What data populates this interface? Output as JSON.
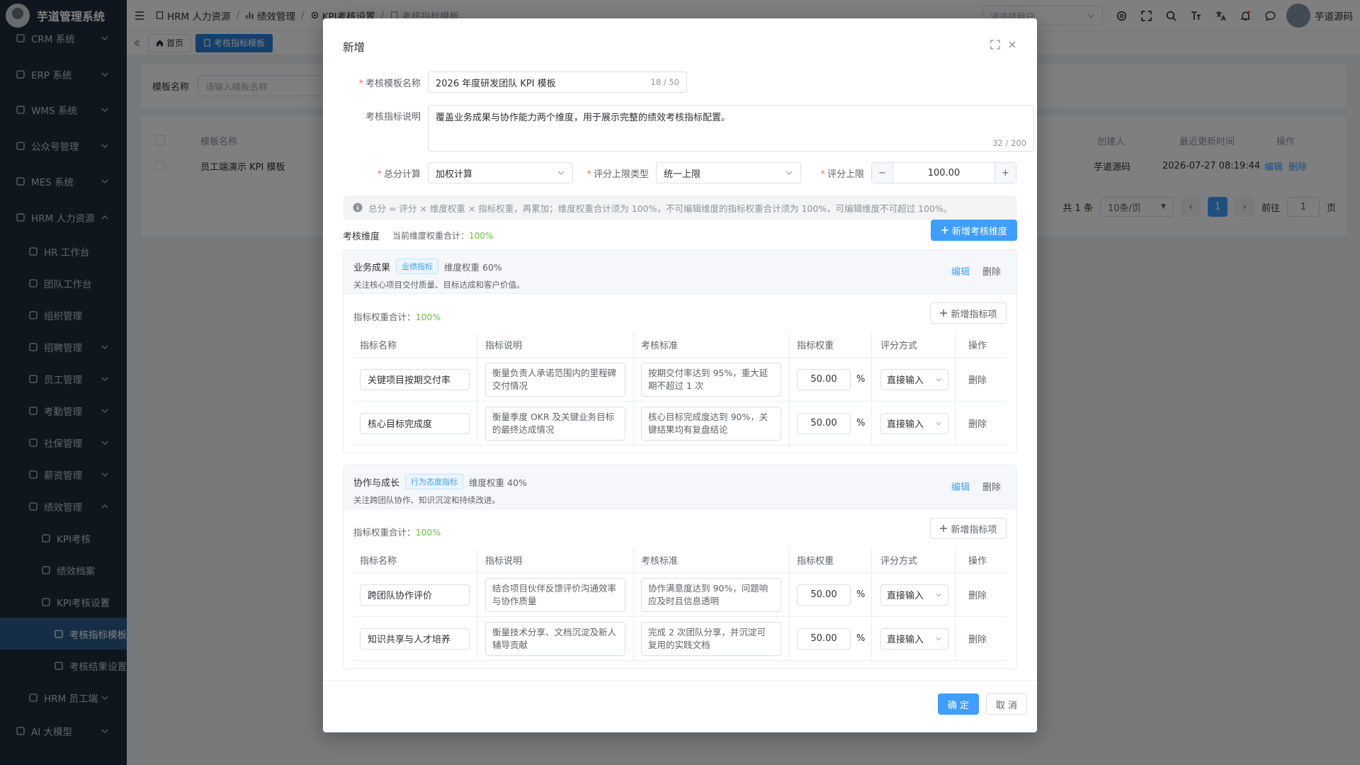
{
  "app": {
    "title": "芋道管理系统"
  },
  "sidebar": {
    "items": [
      {
        "label": "CRM 系统",
        "icon": "crm-icon"
      },
      {
        "label": "ERP 系统",
        "icon": "erp-icon"
      },
      {
        "label": "WMS 系统",
        "icon": "wms-icon"
      },
      {
        "label": "公众号管理",
        "icon": "wechat-icon"
      },
      {
        "label": "MES 系统",
        "icon": "mes-icon"
      },
      {
        "label": "HRM 人力资源",
        "icon": "hrm-icon"
      },
      {
        "label": "HR 工作台"
      },
      {
        "label": "团队工作台"
      },
      {
        "label": "组织管理"
      },
      {
        "label": "招聘管理"
      },
      {
        "label": "员工管理"
      },
      {
        "label": "考勤管理"
      },
      {
        "label": "社保管理"
      },
      {
        "label": "薪资管理"
      },
      {
        "label": "绩效管理"
      },
      {
        "label": "KPI考核"
      },
      {
        "label": "绩效档案"
      },
      {
        "label": "KPI考核设置"
      },
      {
        "label": "考核指标模板"
      },
      {
        "label": "考核结果设置"
      },
      {
        "label": "HRM 员工端"
      },
      {
        "label": "AI 大模型"
      }
    ]
  },
  "breadcrumb": [
    "HRM 人力资源",
    "绩效管理",
    "KPI考核设置",
    "考核指标模板"
  ],
  "header": {
    "tenant_placeholder": "请选择租户",
    "user_name": "芋道源码"
  },
  "tabs": [
    "首页",
    "考核指标模板"
  ],
  "page": {
    "search_label": "模板名称",
    "search_placeholder": "请输入模板名称",
    "table_headers": [
      "模板名称",
      "创建人",
      "最近更新时间",
      "操作"
    ],
    "row": {
      "name": "员工端演示 KPI 模板",
      "creator": "芋道源码",
      "updated": "2026-07-27 08:19:44",
      "edit": "编辑",
      "delete": "删除"
    },
    "pager": {
      "total": "共 1 条",
      "size": "10条/页",
      "page": "1",
      "goto": "前往",
      "goto_val": "1",
      "unit": "页"
    }
  },
  "dialog": {
    "title": "新增",
    "template_name_label": "考核模板名称",
    "template_name_value": "2026 年度研发团队 KPI 模板",
    "template_name_count": "18 / 50",
    "desc_label": "考核指标说明",
    "desc_value": "覆盖业务成果与协作能力两个维度，用于展示完整的绩效考核指标配置。",
    "desc_count": "32 / 200",
    "total_calc_label": "总分计算",
    "total_calc_value": "加权计算",
    "limit_type_label": "评分上限类型",
    "limit_type_value": "统一上限",
    "limit_label": "评分上限",
    "limit_value": "100.00",
    "info_text": "总分 = 评分 × 维度权重 × 指标权重，再累加；维度权重合计须为 100%，不可编辑维度的指标权重合计须为 100%，可编辑维度不可超过 100%。",
    "dim_section_label": "考核维度",
    "dim_weight_total_label": "当前维度权重合计：",
    "dim_weight_total_value": "100%",
    "add_dim_button": "新增考核维度",
    "ind_weight_label": "指标权重合计：",
    "add_ind_button": "新增指标项",
    "col_headers": [
      "指标名称",
      "指标说明",
      "考核标准",
      "指标权重",
      "评分方式",
      "操作"
    ],
    "edit_label": "编辑",
    "delete_label": "删除",
    "dimensions": [
      {
        "name": "业务成果",
        "tag": "业绩指标",
        "weight": "维度权重 60%",
        "desc": "关注核心项目交付质量、目标达成和客户价值。",
        "ind_total": "100%",
        "rows": [
          {
            "name": "关键项目按期交付率",
            "desc": "衡量负责人承诺范围内的里程碑交付情况",
            "std": "按期交付率达到 95%，重大延期不超过 1 次",
            "weight": "50.00",
            "unit": "%",
            "method": "直接输入",
            "op": "删除"
          },
          {
            "name": "核心目标完成度",
            "desc": "衡量季度 OKR 及关键业务目标的最终达成情况",
            "std": "核心目标完成度达到 90%，关键结果均有复盘结论",
            "weight": "50.00",
            "unit": "%",
            "method": "直接输入",
            "op": "删除"
          }
        ]
      },
      {
        "name": "协作与成长",
        "tag": "行为态度指标",
        "weight": "维度权重 40%",
        "desc": "关注跨团队协作、知识沉淀和持续改进。",
        "ind_total": "100%",
        "rows": [
          {
            "name": "跨团队协作评价",
            "desc": "结合项目伙伴反馈评价沟通效率与协作质量",
            "std": "协作满意度达到 90%，问题响应及时且信息透明",
            "weight": "50.00",
            "unit": "%",
            "method": "直接输入",
            "op": "删除"
          },
          {
            "name": "知识共享与人才培养",
            "desc": "衡量技术分享、文档沉淀及新人辅导贡献",
            "std": "完成 2 次团队分享，并沉淀可复用的实践文档",
            "weight": "50.00",
            "unit": "%",
            "method": "直接输入",
            "op": "删除"
          }
        ]
      }
    ],
    "confirm_button": "确 定",
    "cancel_button": "取 消"
  }
}
